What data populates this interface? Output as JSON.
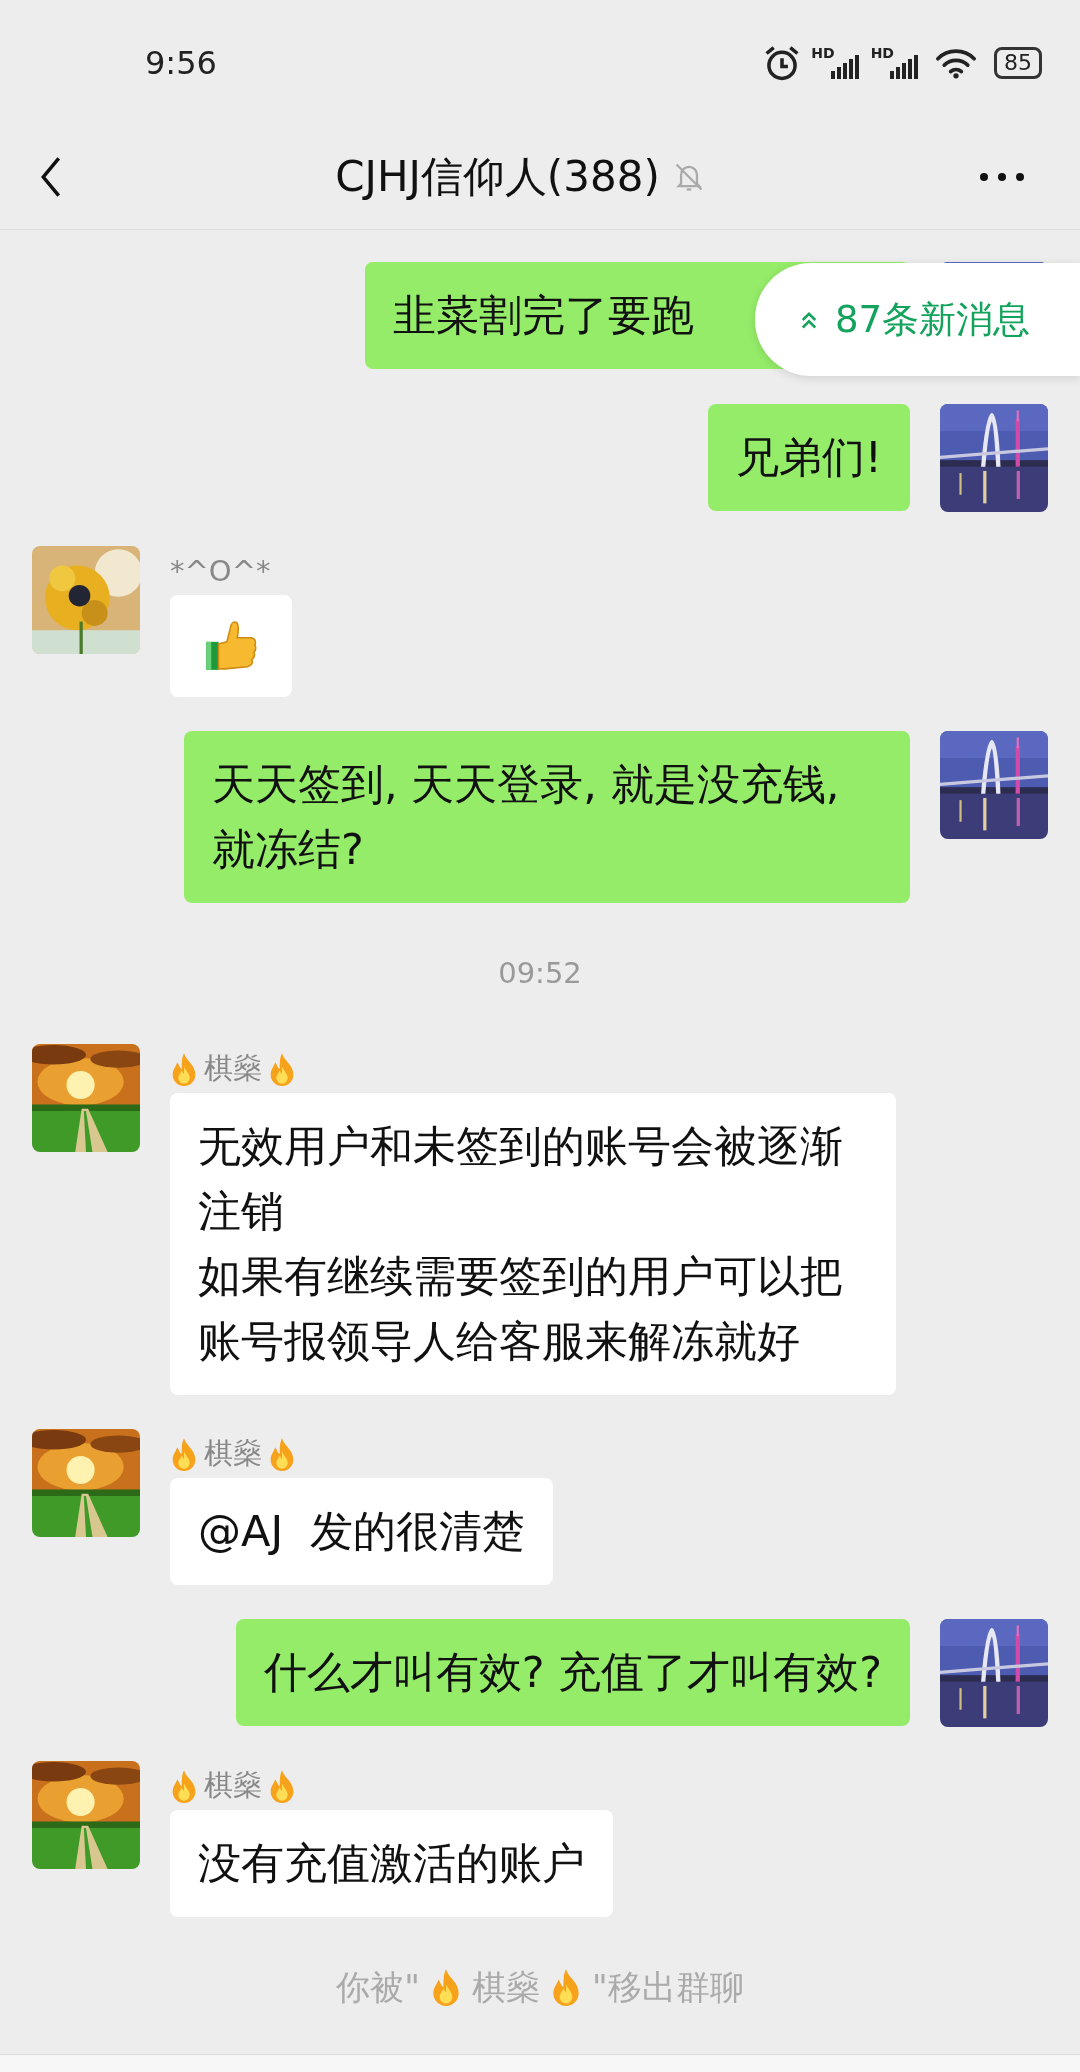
{
  "status_bar": {
    "time": "9:56",
    "network_labels": [
      "HD",
      "HD"
    ],
    "battery": "85"
  },
  "header": {
    "title": "CJHJ信仰人(388)",
    "muted": true
  },
  "new_messages": {
    "label": "87条新消息"
  },
  "messages": [
    {
      "kind": "outgoing_text",
      "paragraphs": [
        "韭菜割完了要跑"
      ]
    },
    {
      "kind": "outgoing_text",
      "paragraphs": [
        "兄弟们!"
      ]
    },
    {
      "kind": "incoming_sticker",
      "sender": {
        "name": "*^O^*",
        "flames": false
      }
    },
    {
      "kind": "outgoing_text",
      "paragraphs": [
        "天天签到, 天天登录, 就是没充钱, 就冻结?"
      ]
    },
    {
      "kind": "time",
      "text": "09:52"
    },
    {
      "kind": "incoming_text",
      "sender": {
        "name": "棋燊",
        "flames": true
      },
      "paragraphs": [
        "无效用户和未签到的账号会被逐渐注销",
        "如果有继续需要签到的用户可以把账号报领导人给客服来解冻就好"
      ]
    },
    {
      "kind": "incoming_text",
      "sender": {
        "name": "棋燊",
        "flames": true
      },
      "paragraphs": [
        "@AJ  发的很清楚"
      ]
    },
    {
      "kind": "outgoing_text",
      "paragraphs": [
        "什么才叫有效? 充值了才叫有效?"
      ]
    },
    {
      "kind": "incoming_text",
      "sender": {
        "name": "棋燊",
        "flames": true
      },
      "paragraphs": [
        "没有充值激活的账户"
      ]
    }
  ],
  "notice": {
    "parts": [
      {
        "kind": "text",
        "text": "你被\""
      },
      {
        "kind": "flame"
      },
      {
        "kind": "text",
        "text": "棋燊"
      },
      {
        "kind": "flame"
      },
      {
        "kind": "text",
        "text": "\"移出群聊"
      }
    ]
  }
}
